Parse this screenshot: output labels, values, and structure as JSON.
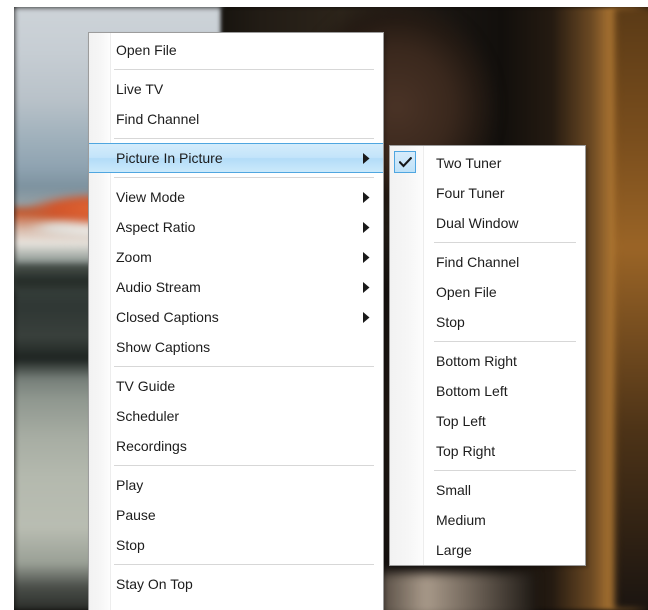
{
  "app": {
    "background_description": "blurred video frame of an outdoor street scene on the left and a person's head and shoulder on the right"
  },
  "colors": {
    "menu_background": "#ffffff",
    "menu_border": "#9c9c9c",
    "menu_gutter": "#f4f4f4",
    "highlight_fill": "#c3e4fa",
    "highlight_border": "#4fa6e0",
    "text": "#1c1c1c",
    "separator": "#d7d7d7"
  },
  "context_menu": {
    "name": "player-context-menu",
    "groups": [
      {
        "items": [
          {
            "label": "Open File",
            "icon": null,
            "submenu": false,
            "checked": false
          }
        ]
      },
      {
        "items": [
          {
            "label": "Live TV",
            "icon": null,
            "submenu": false,
            "checked": false
          },
          {
            "label": "Find Channel",
            "icon": null,
            "submenu": false,
            "checked": false
          }
        ]
      },
      {
        "items": [
          {
            "label": "Picture In Picture",
            "icon": "submenu-arrow-icon",
            "submenu": true,
            "checked": false,
            "highlighted": true
          }
        ]
      },
      {
        "items": [
          {
            "label": "View Mode",
            "icon": "submenu-arrow-icon",
            "submenu": true,
            "checked": false
          },
          {
            "label": "Aspect Ratio",
            "icon": "submenu-arrow-icon",
            "submenu": true,
            "checked": false
          },
          {
            "label": "Zoom",
            "icon": "submenu-arrow-icon",
            "submenu": true,
            "checked": false
          },
          {
            "label": "Audio Stream",
            "icon": "submenu-arrow-icon",
            "submenu": true,
            "checked": false
          },
          {
            "label": "Closed Captions",
            "icon": "submenu-arrow-icon",
            "submenu": true,
            "checked": false
          },
          {
            "label": "Show Captions",
            "icon": null,
            "submenu": false,
            "checked": false
          }
        ]
      },
      {
        "items": [
          {
            "label": "TV Guide",
            "icon": null,
            "submenu": false,
            "checked": false
          },
          {
            "label": "Scheduler",
            "icon": null,
            "submenu": false,
            "checked": false
          },
          {
            "label": "Recordings",
            "icon": null,
            "submenu": false,
            "checked": false
          }
        ]
      },
      {
        "items": [
          {
            "label": "Play",
            "icon": null,
            "submenu": false,
            "checked": false
          },
          {
            "label": "Pause",
            "icon": null,
            "submenu": false,
            "checked": false
          },
          {
            "label": "Stop",
            "icon": null,
            "submenu": false,
            "checked": false
          }
        ]
      },
      {
        "items": [
          {
            "label": "Stay On Top",
            "icon": null,
            "submenu": false,
            "checked": false
          }
        ]
      }
    ]
  },
  "pip_submenu": {
    "name": "picture-in-picture-submenu",
    "parent_item": "Picture In Picture",
    "groups": [
      {
        "items": [
          {
            "label": "Two Tuner",
            "checked": true,
            "icon": "check-icon"
          },
          {
            "label": "Four Tuner",
            "checked": false,
            "icon": null
          },
          {
            "label": "Dual Window",
            "checked": false,
            "icon": null
          }
        ]
      },
      {
        "items": [
          {
            "label": "Find Channel",
            "checked": false,
            "icon": null
          },
          {
            "label": "Open File",
            "checked": false,
            "icon": null
          },
          {
            "label": "Stop",
            "checked": false,
            "icon": null
          }
        ]
      },
      {
        "items": [
          {
            "label": "Bottom Right",
            "checked": false,
            "icon": null
          },
          {
            "label": "Bottom Left",
            "checked": false,
            "icon": null
          },
          {
            "label": "Top Left",
            "checked": false,
            "icon": null
          },
          {
            "label": "Top Right",
            "checked": false,
            "icon": null
          }
        ]
      },
      {
        "items": [
          {
            "label": "Small",
            "checked": false,
            "icon": null
          },
          {
            "label": "Medium",
            "checked": false,
            "icon": null
          },
          {
            "label": "Large",
            "checked": false,
            "icon": null
          }
        ]
      }
    ]
  }
}
